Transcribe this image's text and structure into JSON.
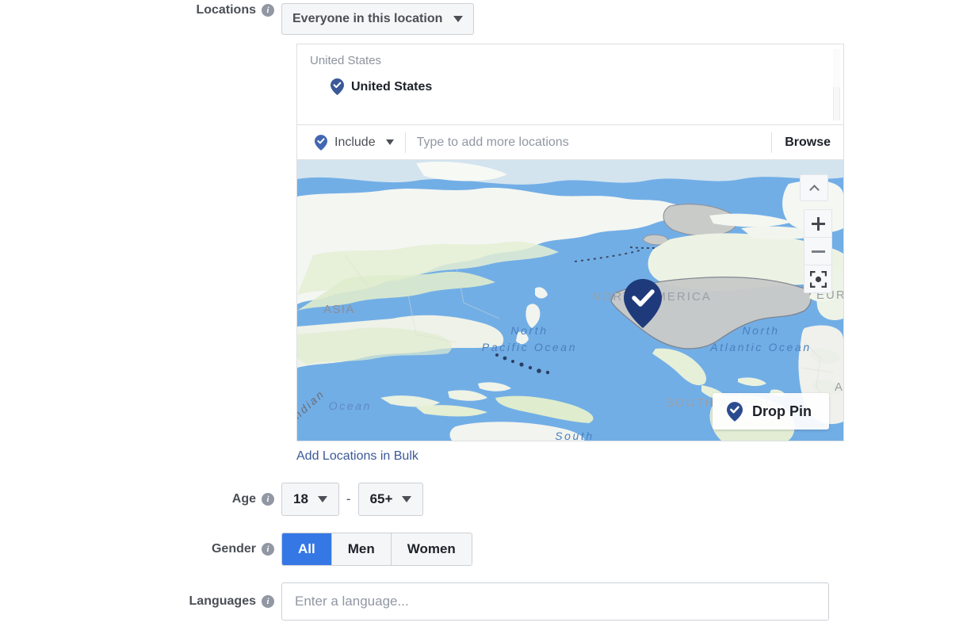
{
  "locations": {
    "label": "Locations",
    "info_icon": "info-icon",
    "mode_dropdown": {
      "value": "Everyone in this location",
      "caret_icon": "caret-down-icon"
    },
    "list": {
      "group_title": "United States",
      "items": [
        {
          "name": "United States",
          "pin_icon": "location-pin-check-icon"
        }
      ]
    },
    "searchbar": {
      "include_label": "Include",
      "include_pin_icon": "location-pin-check-icon",
      "include_caret_icon": "caret-down-icon",
      "input_placeholder": "Type to add more locations",
      "input_value": "",
      "browse_label": "Browse"
    },
    "map": {
      "continent_labels": [
        {
          "text": "ASIA"
        },
        {
          "text": "NORTH AMERICA"
        },
        {
          "text": "SOUTH AMERICA"
        },
        {
          "text": "EUROPE"
        },
        {
          "text": "AFRICA"
        }
      ],
      "ocean_labels": [
        {
          "line1": "North",
          "line2": "Pacific Ocean"
        },
        {
          "line1": "North",
          "line2": "Atlantic Ocean"
        },
        {
          "line1": "Indian",
          "line2": "Ocean"
        },
        {
          "line1": "South",
          "line2": ""
        }
      ],
      "controls": {
        "collapse": "chevron-up-icon",
        "zoom_in": "plus-icon",
        "zoom_out": "minus-icon",
        "locate": "fullscreen-target-icon"
      },
      "drop_pin": {
        "label": "Drop Pin",
        "pin_icon": "location-pin-check-icon"
      },
      "marker_icon": "map-marker-check-icon",
      "colors": {
        "water": "#72aee6",
        "land": "#f2f4ef",
        "green": "#dfeccd",
        "selected_country": "#c9cbc9",
        "marker": "#1e3a7b"
      }
    },
    "bulk_link": "Add Locations in Bulk"
  },
  "age": {
    "label": "Age",
    "info_icon": "info-icon",
    "min": {
      "value": "18",
      "caret_icon": "caret-down-icon"
    },
    "separator": "-",
    "max": {
      "value": "65+",
      "caret_icon": "caret-down-icon"
    }
  },
  "gender": {
    "label": "Gender",
    "info_icon": "info-icon",
    "options": [
      {
        "label": "All",
        "selected": true
      },
      {
        "label": "Men",
        "selected": false
      },
      {
        "label": "Women",
        "selected": false
      }
    ],
    "accent_color": "#3578e5"
  },
  "languages": {
    "label": "Languages",
    "info_icon": "info-icon",
    "placeholder": "Enter a language...",
    "value": ""
  }
}
